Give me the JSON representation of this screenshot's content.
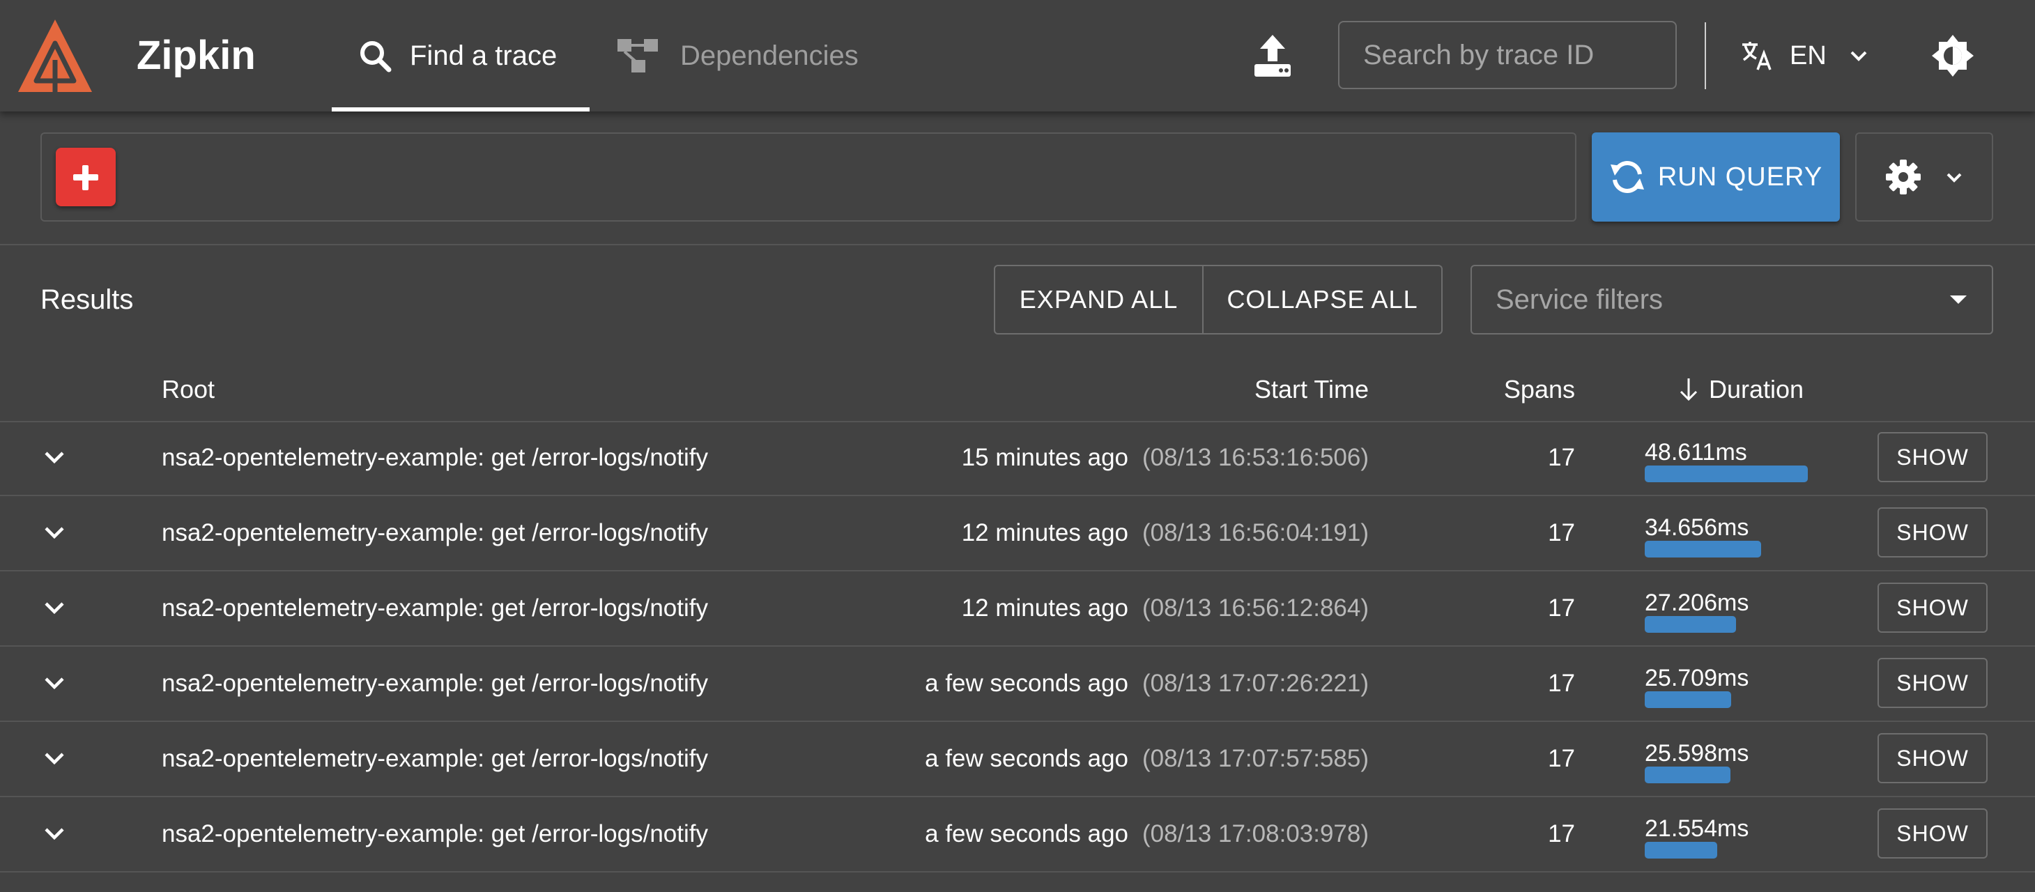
{
  "header": {
    "brand": "Zipkin",
    "tabs": [
      {
        "label": "Find a trace",
        "active": true
      },
      {
        "label": "Dependencies",
        "active": false
      }
    ],
    "search_placeholder": "Search by trace ID",
    "language": "EN",
    "accent_color": "#3f86c6",
    "logo_color": "#e4683e"
  },
  "query": {
    "run_label": "RUN QUERY",
    "add_icon": "plus-icon",
    "settings_icon": "gear-icon"
  },
  "results": {
    "title": "Results",
    "expand_all": "EXPAND ALL",
    "collapse_all": "COLLAPSE ALL",
    "service_filter_placeholder": "Service filters",
    "columns": {
      "root": "Root",
      "start_time": "Start Time",
      "spans": "Spans",
      "duration": "Duration"
    },
    "sort": {
      "column": "duration",
      "direction": "desc"
    },
    "show_label": "SHOW",
    "rows": [
      {
        "root": "nsa2-opentelemetry-example: get /error-logs/notify",
        "relative": "15 minutes ago",
        "absolute": "(08/13 16:53:16:506)",
        "spans": "17",
        "duration": "48.611ms",
        "duration_fraction": 1.0
      },
      {
        "root": "nsa2-opentelemetry-example: get /error-logs/notify",
        "relative": "12 minutes ago",
        "absolute": "(08/13 16:56:04:191)",
        "spans": "17",
        "duration": "34.656ms",
        "duration_fraction": 0.713
      },
      {
        "root": "nsa2-opentelemetry-example: get /error-logs/notify",
        "relative": "12 minutes ago",
        "absolute": "(08/13 16:56:12:864)",
        "spans": "17",
        "duration": "27.206ms",
        "duration_fraction": 0.56
      },
      {
        "root": "nsa2-opentelemetry-example: get /error-logs/notify",
        "relative": "a few seconds ago",
        "absolute": "(08/13 17:07:26:221)",
        "spans": "17",
        "duration": "25.709ms",
        "duration_fraction": 0.529
      },
      {
        "root": "nsa2-opentelemetry-example: get /error-logs/notify",
        "relative": "a few seconds ago",
        "absolute": "(08/13 17:07:57:585)",
        "spans": "17",
        "duration": "25.598ms",
        "duration_fraction": 0.527
      },
      {
        "root": "nsa2-opentelemetry-example: get /error-logs/notify",
        "relative": "a few seconds ago",
        "absolute": "(08/13 17:08:03:978)",
        "spans": "17",
        "duration": "21.554ms",
        "duration_fraction": 0.443
      }
    ]
  }
}
